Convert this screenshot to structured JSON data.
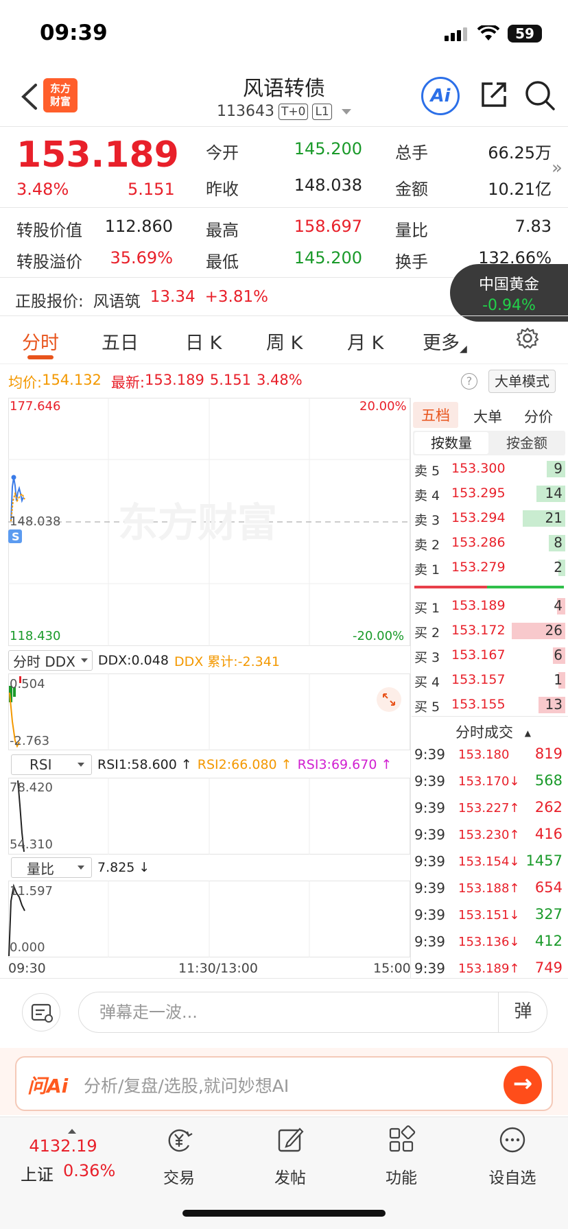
{
  "status": {
    "time": "09:39",
    "battery": "59"
  },
  "header": {
    "logo_text_1": "东方",
    "logo_text_2": "财富",
    "title": "风语转债",
    "code": "113643",
    "tag1": "T+0",
    "tag2": "L1",
    "ai_label": "Ai"
  },
  "quote": {
    "price": "153.189",
    "pct": "3.48%",
    "change": "5.151",
    "fields": [
      {
        "label": "今开",
        "value": "145.200"
      },
      {
        "label": "总手",
        "value": "66.25万"
      },
      {
        "label": "昨收",
        "value": "148.038"
      },
      {
        "label": "金额",
        "value": "10.21亿"
      },
      {
        "label": "转股价值",
        "value": "112.860"
      },
      {
        "label": "最高",
        "value": "158.697"
      },
      {
        "label": "量比",
        "value": "7.83"
      },
      {
        "label": "转股溢价",
        "value": "35.69%"
      },
      {
        "label": "最低",
        "value": "145.200"
      },
      {
        "label": "换手",
        "value": "132.66%"
      }
    ],
    "more": "»"
  },
  "underlying": {
    "label": "正股报价:",
    "name": "风语筑",
    "price": "13.34",
    "pct": "+3.81%"
  },
  "gold_badge": {
    "name": "中国黄金",
    "pct": "-0.94%"
  },
  "tabs": [
    "分时",
    "五日",
    "日 K",
    "周 K",
    "月 K",
    "更多"
  ],
  "avg_line": {
    "avg_label": "均价:",
    "avg_value": "154.132",
    "latest_label": "最新:",
    "latest_price": "153.189",
    "latest_change": "5.151",
    "latest_pct": "3.48%",
    "help": "?",
    "big_order": "大单模式"
  },
  "main_chart": {
    "y_top": "177.646",
    "y_mid": "148.038",
    "y_bot": "118.430",
    "pct_top": "20.00%",
    "pct_bot": "-20.00%",
    "watermark": "东方财富",
    "s_marker": "S",
    "x_labels": [
      "09:30",
      "11:30/13:00",
      "15:00"
    ]
  },
  "ddx": {
    "select": "分时 DDX",
    "ddx": "DDX:0.048",
    "ddx_sum": "DDX 累计:-2.341",
    "y_top": "0.504",
    "y_bot": "-2.763"
  },
  "rsi": {
    "select": "RSI",
    "rsi1": "RSI1:58.600 ↑",
    "rsi2": "RSI2:66.080 ↑",
    "rsi3": "RSI3:69.670 ↑",
    "y_top": "78.420",
    "y_bot": "54.310"
  },
  "volratio": {
    "select": "量比",
    "value": "7.825 ↓",
    "y_top": "11.597",
    "y_bot": "0.000"
  },
  "orderbook": {
    "tabs": [
      "五档",
      "大单",
      "分价"
    ],
    "seg_on": "按数量",
    "seg_off": "按金额",
    "asks": [
      {
        "label": "卖 5",
        "price": "153.300",
        "vol": "9",
        "ratio": 0.35
      },
      {
        "label": "卖 4",
        "price": "153.295",
        "vol": "14",
        "ratio": 0.54
      },
      {
        "label": "卖 3",
        "price": "153.294",
        "vol": "21",
        "ratio": 0.8
      },
      {
        "label": "卖 2",
        "price": "153.286",
        "vol": "8",
        "ratio": 0.31
      },
      {
        "label": "卖 1",
        "price": "153.279",
        "vol": "2",
        "ratio": 0.08
      }
    ],
    "bids": [
      {
        "label": "买 1",
        "price": "153.189",
        "vol": "4",
        "ratio": 0.15
      },
      {
        "label": "买 2",
        "price": "153.172",
        "vol": "26",
        "ratio": 1.0
      },
      {
        "label": "买 3",
        "price": "153.167",
        "vol": "6",
        "ratio": 0.23
      },
      {
        "label": "买 4",
        "price": "153.157",
        "vol": "1",
        "ratio": 0.04
      },
      {
        "label": "买 5",
        "price": "153.155",
        "vol": "13",
        "ratio": 0.5
      }
    ],
    "trades_title": "分时成交",
    "trades": [
      {
        "time": "9:39",
        "price": "153.180",
        "arrow": "",
        "vol": "819",
        "dir": "up"
      },
      {
        "time": "9:39",
        "price": "153.170↓",
        "arrow": "",
        "vol": "568",
        "dir": "down"
      },
      {
        "time": "9:39",
        "price": "153.227↑",
        "arrow": "",
        "vol": "262",
        "dir": "up"
      },
      {
        "time": "9:39",
        "price": "153.230↑",
        "arrow": "",
        "vol": "416",
        "dir": "up"
      },
      {
        "time": "9:39",
        "price": "153.154↓",
        "arrow": "",
        "vol": "1457",
        "dir": "down"
      },
      {
        "time": "9:39",
        "price": "153.188↑",
        "arrow": "",
        "vol": "654",
        "dir": "up"
      },
      {
        "time": "9:39",
        "price": "153.151↓",
        "arrow": "",
        "vol": "327",
        "dir": "down"
      },
      {
        "time": "9:39",
        "price": "153.136↓",
        "arrow": "",
        "vol": "412",
        "dir": "down"
      },
      {
        "time": "9:39",
        "price": "153.189↑",
        "arrow": "",
        "vol": "749",
        "dir": "up"
      }
    ]
  },
  "comment": {
    "placeholder": "弹幕走一波...",
    "danmu": "弹"
  },
  "ask_ai": {
    "brand": "问Ai",
    "placeholder": "分析/复盘/选股,就问妙想AI",
    "go": "→"
  },
  "nav": {
    "index_value": "4132.19",
    "index_name": "上证",
    "index_pct": "0.36%",
    "items": [
      "交易",
      "发帖",
      "功能",
      "设自选"
    ]
  },
  "colors": {
    "up": "#e8202a",
    "down": "#1a9a2a",
    "accent": "#e8541c",
    "ai_blue": "#2b6fe8"
  }
}
